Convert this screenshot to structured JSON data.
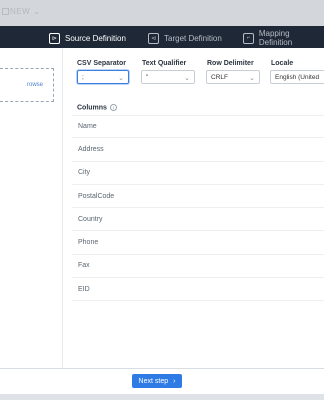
{
  "topbar": {
    "title": "NEW"
  },
  "steps": [
    {
      "label": "Source Definition",
      "icon": "source-icon",
      "active": true
    },
    {
      "label": "Target Definition",
      "icon": "target-icon",
      "active": false
    },
    {
      "label": "Mapping Definition",
      "icon": "mapping-icon",
      "active": false
    }
  ],
  "left": {
    "dropzone_link": "rowse"
  },
  "fields": {
    "csv_separator": {
      "label": "CSV Separator",
      "value": ";"
    },
    "text_qualifier": {
      "label": "Text Qualifier",
      "value": "\""
    },
    "row_delimiter": {
      "label": "Row Delimiter",
      "value": "CRLF"
    },
    "locale": {
      "label": "Locale",
      "value": "English (United"
    }
  },
  "columns": {
    "label": "Columns",
    "items": [
      "Name",
      "Address",
      "City",
      "PostalCode",
      "Country",
      "Phone",
      "Fax",
      "EID"
    ]
  },
  "footer": {
    "next_label": "Next step"
  },
  "colors": {
    "accent": "#2f7be6",
    "header_bg": "#1f2837"
  }
}
